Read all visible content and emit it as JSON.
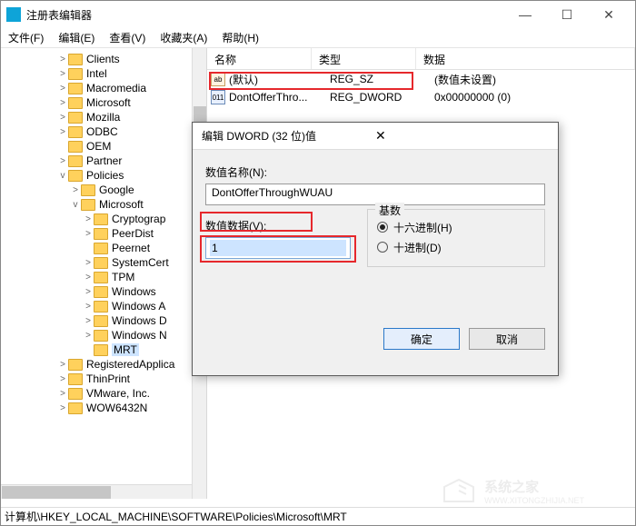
{
  "window": {
    "title": "注册表编辑器",
    "controls": {
      "min": "—",
      "max": "☐",
      "close": "✕"
    }
  },
  "menu": [
    "文件(F)",
    "编辑(E)",
    "查看(V)",
    "收藏夹(A)",
    "帮助(H)"
  ],
  "tree": [
    {
      "d": 4,
      "t": ">",
      "l": "Clients"
    },
    {
      "d": 4,
      "t": ">",
      "l": "Intel"
    },
    {
      "d": 4,
      "t": ">",
      "l": "Macromedia"
    },
    {
      "d": 4,
      "t": ">",
      "l": "Microsoft"
    },
    {
      "d": 4,
      "t": ">",
      "l": "Mozilla"
    },
    {
      "d": 4,
      "t": ">",
      "l": "ODBC"
    },
    {
      "d": 4,
      "t": "",
      "l": "OEM"
    },
    {
      "d": 4,
      "t": ">",
      "l": "Partner"
    },
    {
      "d": 4,
      "t": "v",
      "l": "Policies"
    },
    {
      "d": 5,
      "t": ">",
      "l": "Google"
    },
    {
      "d": 5,
      "t": "v",
      "l": "Microsoft"
    },
    {
      "d": 6,
      "t": ">",
      "l": "Cryptograp"
    },
    {
      "d": 6,
      "t": ">",
      "l": "PeerDist"
    },
    {
      "d": 6,
      "t": "",
      "l": "Peernet"
    },
    {
      "d": 6,
      "t": ">",
      "l": "SystemCert"
    },
    {
      "d": 6,
      "t": ">",
      "l": "TPM"
    },
    {
      "d": 6,
      "t": ">",
      "l": "Windows"
    },
    {
      "d": 6,
      "t": ">",
      "l": "Windows A"
    },
    {
      "d": 6,
      "t": ">",
      "l": "Windows D"
    },
    {
      "d": 6,
      "t": ">",
      "l": "Windows N"
    },
    {
      "d": 6,
      "t": "",
      "l": "MRT",
      "sel": true
    },
    {
      "d": 4,
      "t": ">",
      "l": "RegisteredApplica"
    },
    {
      "d": 4,
      "t": ">",
      "l": "ThinPrint"
    },
    {
      "d": 4,
      "t": ">",
      "l": "VMware, Inc."
    },
    {
      "d": 4,
      "t": ">",
      "l": "WOW6432N"
    }
  ],
  "columns": {
    "name": "名称",
    "type": "类型",
    "data": "数据"
  },
  "values": [
    {
      "icon": "ab",
      "name": "(默认)",
      "type": "REG_SZ",
      "data": "(数值未设置)"
    },
    {
      "icon": "011",
      "name": "DontOfferThro...",
      "type": "REG_DWORD",
      "data": "0x00000000 (0)",
      "hl": true
    }
  ],
  "dialog": {
    "title": "编辑 DWORD (32 位)值",
    "name_label": "数值名称(N):",
    "name_value": "DontOfferThroughWUAU",
    "data_label": "数值数据(V):",
    "data_value": "1",
    "base_label": "基数",
    "radio_hex": "十六进制(H)",
    "radio_dec": "十进制(D)",
    "ok": "确定",
    "cancel": "取消",
    "close": "✕"
  },
  "status": "计算机\\HKEY_LOCAL_MACHINE\\SOFTWARE\\Policies\\Microsoft\\MRT",
  "watermark": {
    "name": "系统之家",
    "url": "WWW.XITONGZHIJIA.NET"
  }
}
